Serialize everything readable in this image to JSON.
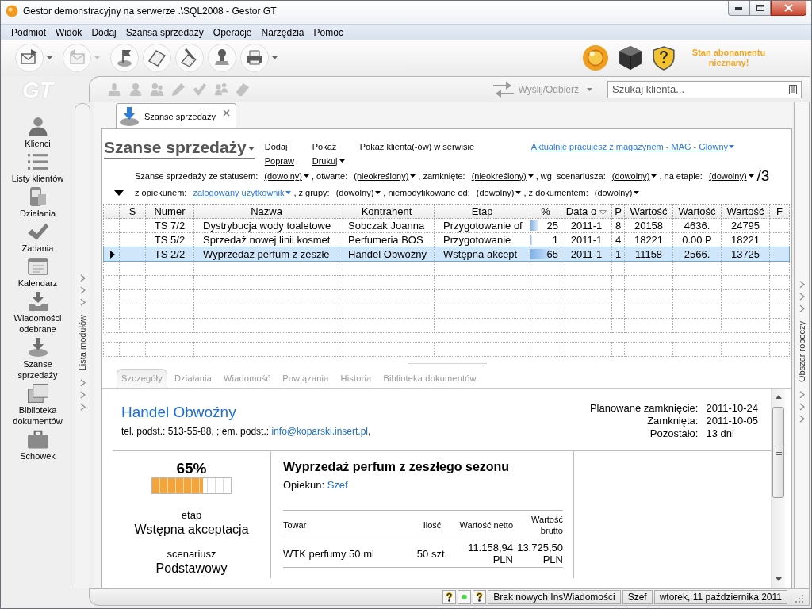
{
  "window": {
    "title": "Gestor demonstracyjny na serwerze .\\SQL2008 - Gestor GT"
  },
  "menu": [
    {
      "label": "Podmiot"
    },
    {
      "label": "Widok"
    },
    {
      "label": "Dodaj"
    },
    {
      "label": "Szansa sprzedaży"
    },
    {
      "label": "Operacje"
    },
    {
      "label": "Narzędzia"
    },
    {
      "label": "Pomoc"
    }
  ],
  "toolbar": {
    "buttons": [
      {
        "dropdown": true,
        "disabled": false
      },
      {
        "dropdown": true,
        "disabled": true
      },
      {
        "dropdown": false,
        "disabled": false
      },
      {
        "dropdown": false,
        "disabled": false
      },
      {
        "dropdown": false,
        "disabled": false
      },
      {
        "dropdown": false,
        "disabled": false
      },
      {
        "dropdown": true,
        "disabled": false
      }
    ],
    "subscription_status": "Stan abonamentu nieznany!"
  },
  "sidebar": {
    "logo": "GT",
    "items": [
      {
        "label": "Klienci"
      },
      {
        "label": "Listy klientów"
      },
      {
        "label": "Działania"
      },
      {
        "label": "Zadania"
      },
      {
        "label": "Kalendarz"
      },
      {
        "label": "Wiadomości odebrane"
      },
      {
        "label": "Szanse sprzedaży"
      },
      {
        "label": "Biblioteka dokumentów"
      },
      {
        "label": "Schowek"
      }
    ]
  },
  "module_strip": {
    "label": "Lista modułów"
  },
  "subtoolbar": {
    "buttons": [
      {
        "disabled": true
      },
      {
        "disabled": true
      },
      {
        "disabled": true
      },
      {
        "disabled": true
      },
      {
        "disabled": true
      },
      {
        "disabled": true
      },
      {
        "disabled": true
      }
    ],
    "send_receive": {
      "label": "Wyślij/Odbierz",
      "disabled": true
    },
    "search": {
      "placeholder": "Szukaj klienta..."
    }
  },
  "document_tabs": [
    {
      "label": "Szanse sprzedaży",
      "selected": true
    }
  ],
  "page": {
    "title": "Szanse sprzedaży",
    "actions": [
      {
        "label": "Dodaj",
        "dropdown": false
      },
      {
        "label": "Pokaż",
        "dropdown": false
      },
      {
        "label": "Pokaż klienta(-ów) w serwisie",
        "dropdown": false
      },
      {
        "label": "Popraw",
        "dropdown": false
      },
      {
        "label": "Drukuj",
        "dropdown": true
      }
    ],
    "warehouse_link": "Aktualnie pracujesz z magazynem - MAG - Główny"
  },
  "filters": {
    "expanded": true,
    "rows": [
      {
        "items": [
          {
            "label": "Szanse sprzedaży ze statusem:",
            "value": "(dowolny)",
            "active": false
          },
          {
            "label": ", otwarte:",
            "value": "(nieokreślony)",
            "active": false
          },
          {
            "label": ", zamknięte:",
            "value": "(nieokreślony)",
            "active": false
          },
          {
            "label": ", wg. scenariusza:",
            "value": "(dowolny)",
            "active": false
          },
          {
            "label": ", na etapie:",
            "value": "(dowolny)",
            "active": false
          }
        ]
      },
      {
        "items": [
          {
            "label": "z opiekunem:",
            "value": "zalogowany użytkownik",
            "active": true
          },
          {
            "label": ", z grupy:",
            "value": "(dowolny)",
            "active": false
          },
          {
            "label": ", niemodyfikowane od:",
            "value": "(dowolny)",
            "active": false
          },
          {
            "label": ", z dokumentem:",
            "value": "(dowolny)",
            "active": false
          }
        ]
      }
    ],
    "counter": "/3"
  },
  "table": {
    "columns": [
      {
        "label": "S",
        "sorted": false
      },
      {
        "label": "Numer",
        "sorted": false
      },
      {
        "label": "Nazwa",
        "sorted": false
      },
      {
        "label": "Kontrahent",
        "sorted": false
      },
      {
        "label": "Etap",
        "sorted": false
      },
      {
        "label": "%",
        "sorted": false
      },
      {
        "label": "Data o",
        "sorted": true
      },
      {
        "label": "P",
        "sorted": false
      },
      {
        "label": "Wartość",
        "sorted": false
      },
      {
        "label": "Wartość",
        "sorted": false
      },
      {
        "label": "Wartość",
        "sorted": false
      },
      {
        "label": "F",
        "sorted": false
      }
    ],
    "rows": [
      {
        "selected": false,
        "level": 0.25,
        "cells": [
          "",
          "TS 7/2",
          "Dystrybucja wody toaletowe",
          "Sobczak Joanna",
          "Przygotowanie of",
          "25",
          "2011-1",
          "8",
          "20158",
          "4636.",
          "24795",
          ""
        ]
      },
      {
        "selected": false,
        "level": 0.01,
        "cells": [
          "",
          "TS 5/2",
          "Sprzedaż nowej linii kosmet",
          "Perfumeria BOS",
          "Przygotowanie",
          "1",
          "2011-1",
          "4",
          "18221",
          "0.00 P",
          "18221",
          ""
        ]
      },
      {
        "selected": true,
        "level": 0.65,
        "cells": [
          "",
          "TS 2/2",
          "Wyprzedaż perfum z zeszłe",
          "Handel Obwoźny",
          "Wstępna akcept",
          "65",
          "2011-1",
          "1",
          "11158",
          "2566.",
          "13725",
          ""
        ]
      }
    ]
  },
  "detail_tabs": [
    {
      "label": "Szczegóły",
      "selected": true
    },
    {
      "label": "Działania",
      "selected": false
    },
    {
      "label": "Wiadomość",
      "selected": false
    },
    {
      "label": "Powiązania",
      "selected": false
    },
    {
      "label": "Historia",
      "selected": false
    },
    {
      "label": "Biblioteka dokumentów",
      "selected": false
    }
  ],
  "details": {
    "client": "Handel Obwoźny",
    "contact": {
      "text": "tel. podst.: 513-55-88, ; em. podst.:",
      "email": "info@koparski.insert.pl",
      "after_email": ","
    },
    "dates": [
      {
        "label": "Planowane zamknięcie:",
        "value": "2011-10-24"
      },
      {
        "label": "Zamknięta:",
        "value": "2011-10-05"
      },
      {
        "label": "Pozostało:",
        "value": "13 dni"
      }
    ],
    "progress": {
      "reading": "65%",
      "level": 0.65
    },
    "stage_label": "etap",
    "stage": "Wstępna akceptacja",
    "scenario_label": "scenariusz",
    "scenario": "Podstawowy",
    "opportunity_title": "Wyprzedaż perfum z zeszłego sezonu",
    "owner_label": "Opiekun:",
    "owner": "Szef",
    "items_table": {
      "columns": [
        "Towar",
        "Ilość",
        "Wartość netto",
        "Wartość brutto"
      ],
      "rows": [
        [
          "WTK perfumy 50 ml",
          "50 szt.",
          "11.158,94 PLN",
          "13.725,50 PLN"
        ]
      ]
    }
  },
  "workspace_strip": {
    "label": "Obszar roboczy"
  },
  "status_bar": {
    "message": "Brak nowych InsWiadomości",
    "user": "Szef",
    "date": "wtorek, 11 października 2011"
  }
}
